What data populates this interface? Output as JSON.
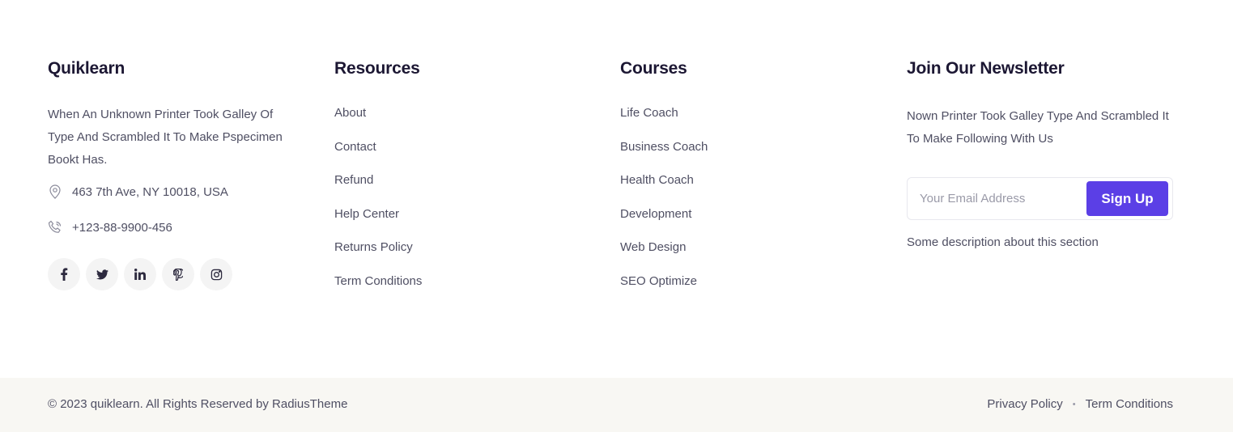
{
  "brand": {
    "title": "Quiklearn",
    "description": "When An Unknown Printer Took Galley Of Type And Scrambled It To Make Pspecimen Bookt Has.",
    "address": "463 7th Ave, NY 10018, USA",
    "phone": "+123-88-9900-456",
    "address_icon": "map-pin-icon",
    "phone_icon": "phone-icon",
    "socials": [
      {
        "icon": "facebook-icon",
        "glyph": "f"
      },
      {
        "icon": "twitter-icon",
        "glyph": "t"
      },
      {
        "icon": "linkedin-icon",
        "glyph": "in"
      },
      {
        "icon": "pinterest-icon",
        "glyph": "p"
      },
      {
        "icon": "instagram-icon",
        "glyph": "ig"
      }
    ]
  },
  "resources": {
    "title": "Resources",
    "links": [
      "About",
      "Contact",
      "Refund",
      "Help Center",
      "Returns Policy",
      "Term Conditions"
    ]
  },
  "courses": {
    "title": "Courses",
    "links": [
      "Life Coach",
      "Business Coach",
      "Health Coach",
      "Development",
      "Web Design",
      "SEO Optimize"
    ]
  },
  "newsletter": {
    "title": "Join Our Newsletter",
    "description": "Nown Printer Took Galley Type And Scrambled It To Make Following With Us",
    "email_placeholder": "Your Email Address",
    "button_label": "Sign Up",
    "note": "Some description about this section"
  },
  "bottom": {
    "copyright": "© 2023 quiklearn. All Rights Reserved by RadiusTheme",
    "links": [
      "Privacy Policy",
      "Term Conditions"
    ]
  },
  "colors": {
    "accent": "#5b3fe6",
    "heading": "#1c1733",
    "bottom_bar": "#f8f7f3"
  }
}
